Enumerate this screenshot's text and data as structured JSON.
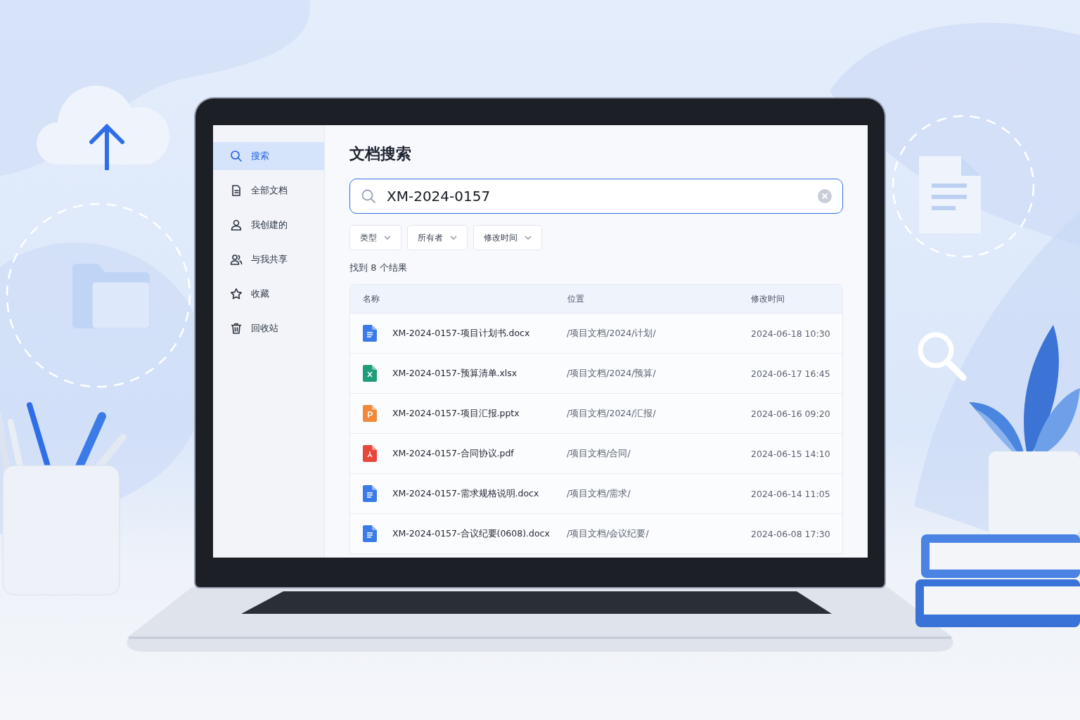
{
  "sidebar": {
    "items": [
      {
        "label": "搜索",
        "selected": true
      },
      {
        "label": "全部文档",
        "selected": false
      },
      {
        "label": "我创建的",
        "selected": false
      },
      {
        "label": "与我共享",
        "selected": false
      },
      {
        "label": "收藏",
        "selected": false
      },
      {
        "label": "回收站",
        "selected": false
      }
    ]
  },
  "page_title": "文档搜索",
  "search": {
    "value": "XM-2024-0157"
  },
  "filters": [
    "类型",
    "所有者",
    "修改时间"
  ],
  "result_count": "找到 8 个结果",
  "table": {
    "columns": [
      "名称",
      "位置",
      "修改时间"
    ],
    "rows": [
      {
        "kind": "docx",
        "name": "XM-2024-0157-项目计划书.docx",
        "location": "/项目文档/2024/计划/",
        "modified": "2024-06-18 10:30"
      },
      {
        "kind": "xlsx",
        "name": "XM-2024-0157-预算清单.xlsx",
        "location": "/项目文档/2024/预算/",
        "modified": "2024-06-17 16:45"
      },
      {
        "kind": "pptx",
        "name": "XM-2024-0157-项目汇报.pptx",
        "location": "/项目文档/2024/汇报/",
        "modified": "2024-06-16 09:20"
      },
      {
        "kind": "pdf",
        "name": "XM-2024-0157-合同协议.pdf",
        "location": "/项目文档/合同/",
        "modified": "2024-06-15 14:10"
      },
      {
        "kind": "docx",
        "name": "XM-2024-0157-需求规格说明.docx",
        "location": "/项目文档/需求/",
        "modified": "2024-06-14 11:05"
      },
      {
        "kind": "docx",
        "name": "XM-2024-0157-合议纪要(0608).docx",
        "location": "/项目文档/会议纪要/",
        "modified": "2024-06-08 17:30"
      }
    ]
  }
}
